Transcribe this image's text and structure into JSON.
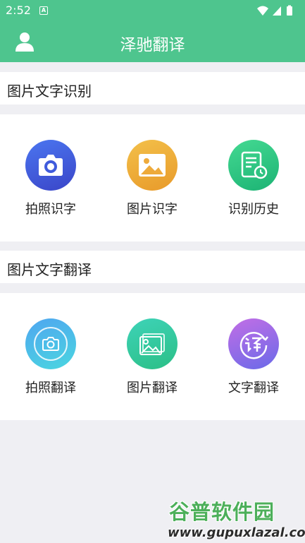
{
  "status_bar": {
    "time": "2:52",
    "notification_letter": "A"
  },
  "app_bar": {
    "title": "泽驰翻译"
  },
  "sections": [
    {
      "title": "图片文字识别",
      "items": [
        {
          "label": "拍照识字",
          "icon": "camera-icon"
        },
        {
          "label": "图片识字",
          "icon": "image-icon"
        },
        {
          "label": "识别历史",
          "icon": "history-icon"
        }
      ]
    },
    {
      "title": "图片文字翻译",
      "items": [
        {
          "label": "拍照翻译",
          "icon": "camera-outline-icon"
        },
        {
          "label": "图片翻译",
          "icon": "image-outline-icon"
        },
        {
          "label": "文字翻译",
          "icon": "translate-char-icon"
        }
      ]
    }
  ],
  "watermark": {
    "title": "谷普软件园",
    "url": "www.gupuxlazal.com"
  },
  "colors": {
    "accent": "#4ec58e",
    "background": "#efeff3"
  }
}
